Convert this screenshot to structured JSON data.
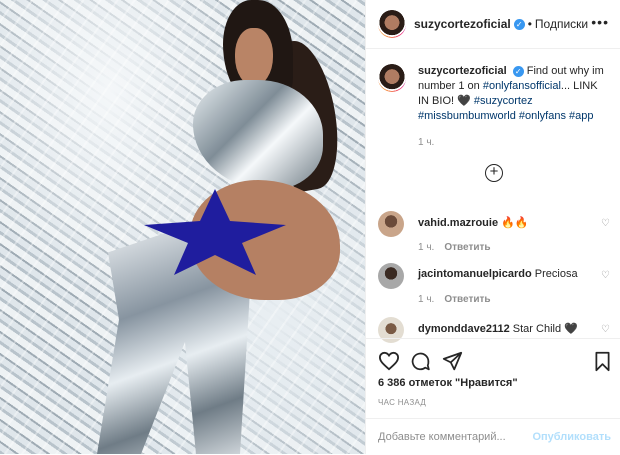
{
  "post": {
    "username": "suzycortezoficial",
    "follow_label": "Подписки",
    "dot": "•",
    "more_label": "•••"
  },
  "caption": {
    "username": "suzycortezoficial",
    "text_before": "Find out why im number 1 on ",
    "tag1": "#onlyfansofficial",
    "text_mid": "... LINK IN BIO! 🖤 ",
    "tag2": "#suzycortez",
    "tag3": "#missbumbumworld",
    "tag4": "#onlyfans",
    "tag5": "#app",
    "time": "1 ч."
  },
  "comments": [
    {
      "username": "vahid.mazrouie",
      "text": "🔥🔥",
      "time": "1 ч.",
      "reply": "Ответить"
    },
    {
      "username": "jacintomanuelpicardo",
      "text": "Preciosa",
      "time": "1 ч.",
      "reply": "Ответить"
    },
    {
      "username": "dymonddave2112",
      "text": "Star Child 🖤",
      "time": "",
      "reply": ""
    }
  ],
  "likes": "6 386 отметок \"Нравится\"",
  "posted_ago": "ЧАС НАЗАД",
  "comment_input": {
    "placeholder": "Добавьте комментарий...",
    "publish_label": "Опубликовать"
  },
  "colors": {
    "verified": "#3897f0",
    "tag": "#00376b",
    "star": "#1f1d9e",
    "publish": "#b2dffc"
  },
  "icons": [
    "heart-icon",
    "comment-icon",
    "share-icon",
    "bookmark-icon",
    "add-circle-icon",
    "verified-badge-icon",
    "more-options-icon"
  ]
}
